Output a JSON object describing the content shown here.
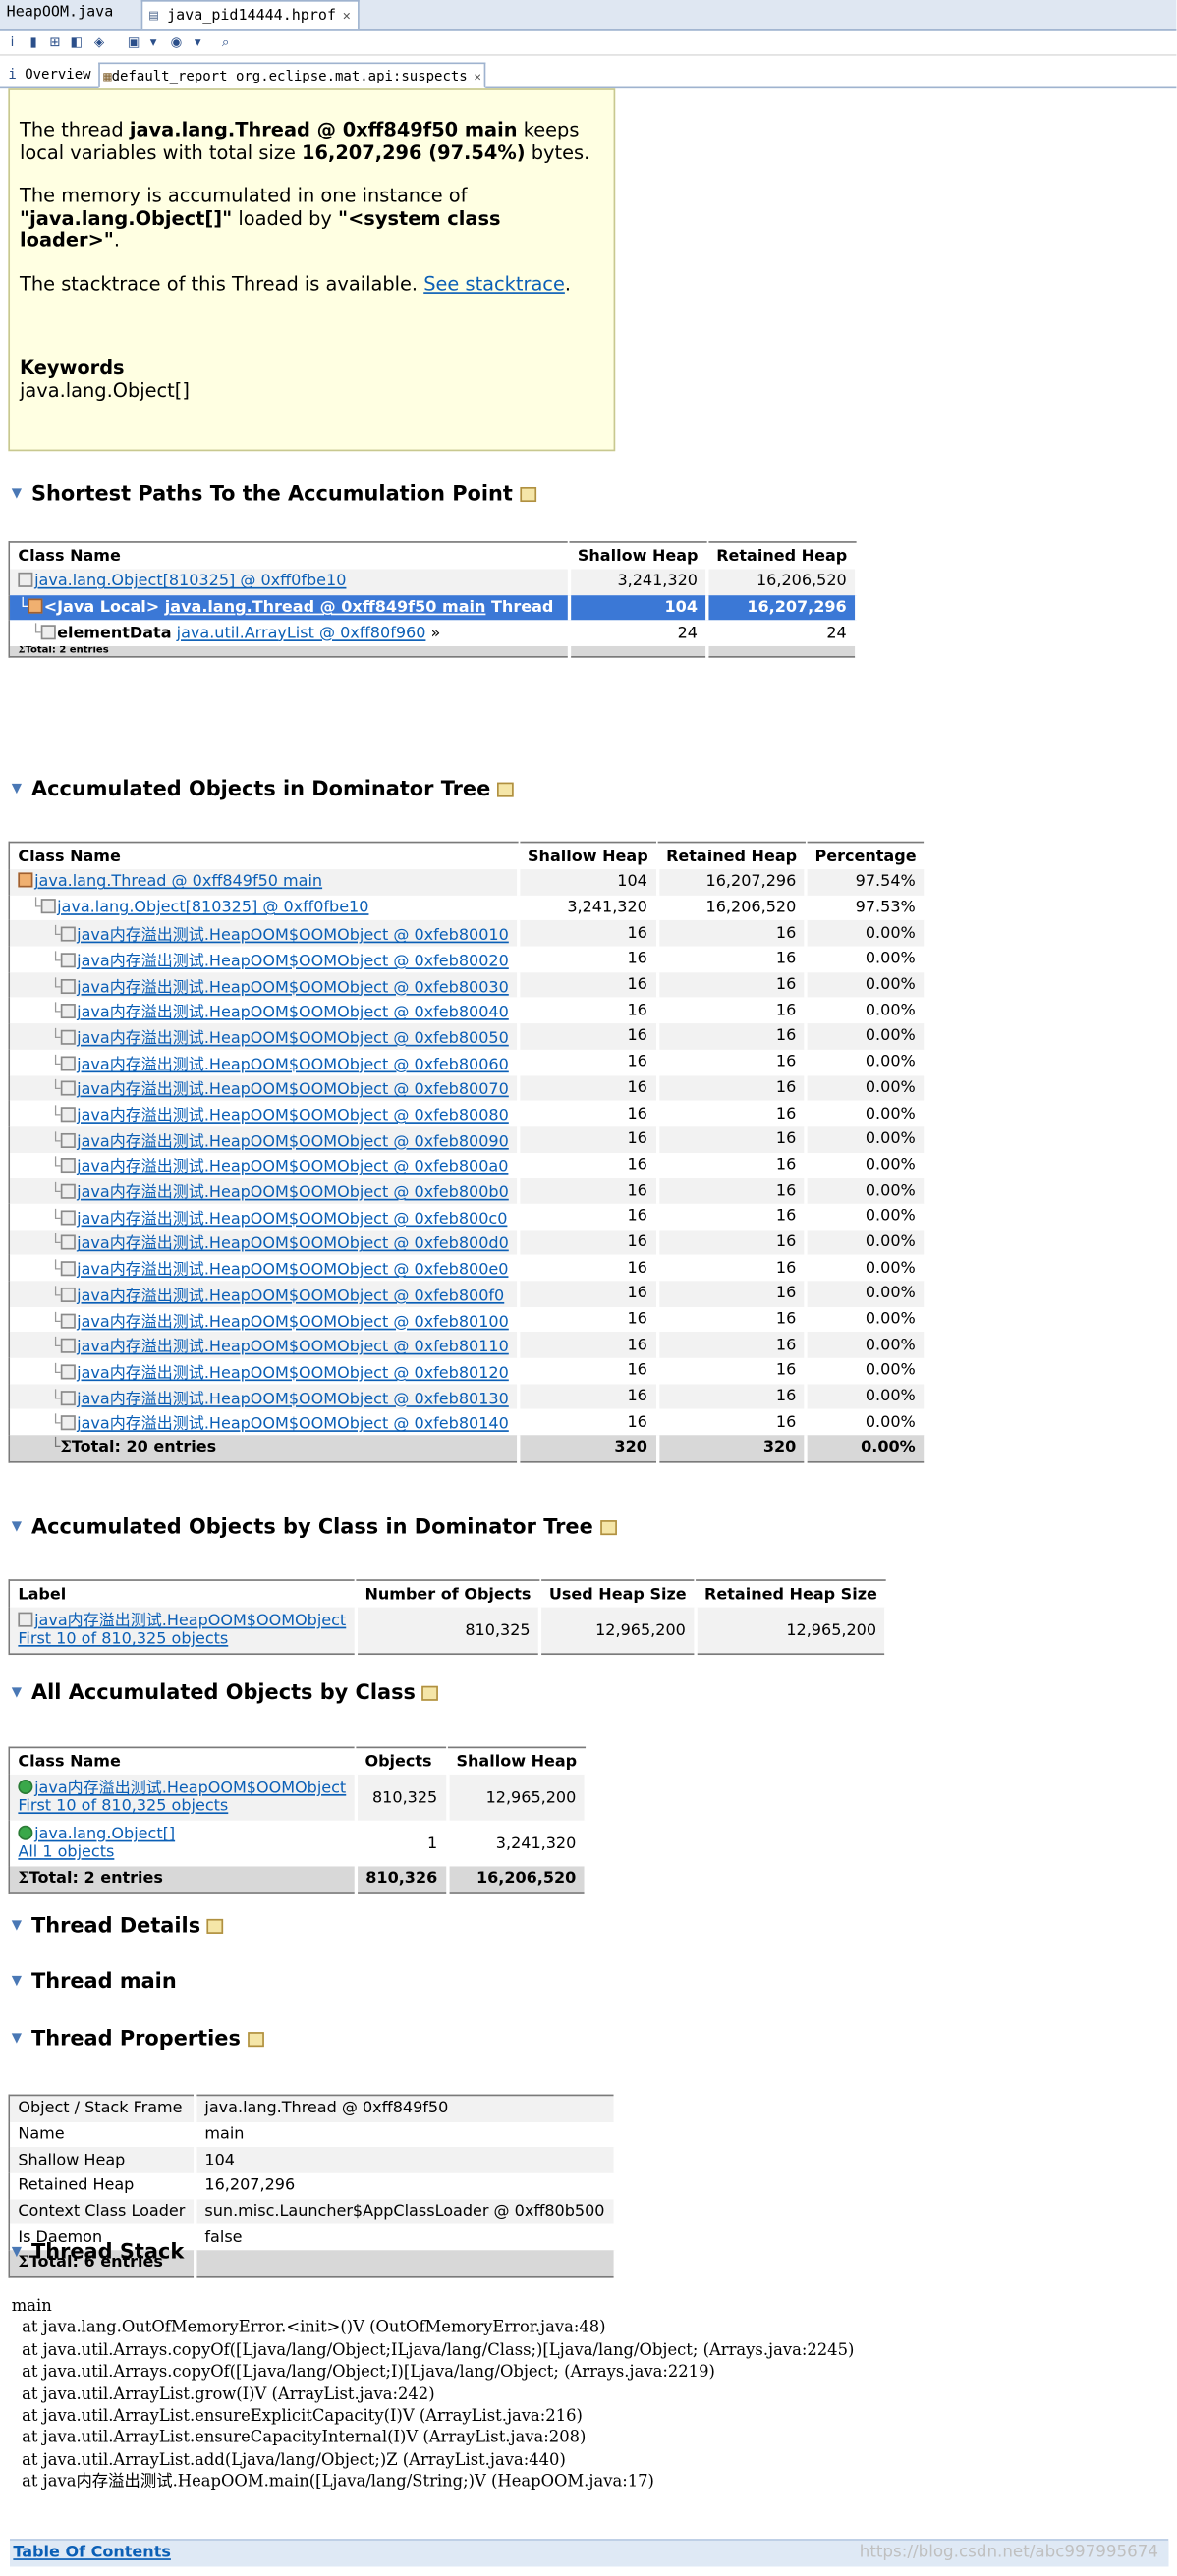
{
  "editor_tabs": [
    {
      "label": "HeapOOM.java"
    },
    {
      "label": "java_pid14444.hprof"
    }
  ],
  "sub_tabs": [
    {
      "label": "Overview"
    },
    {
      "label": "default_report  org.eclipse.mat.api:suspects"
    }
  ],
  "problem": {
    "p1_a": "The thread ",
    "p1_b": "java.lang.Thread @ 0xff849f50 main",
    "p1_c": " keeps local variables with total size ",
    "p1_d": "16,207,296 (97.54%)",
    "p1_e": " bytes.",
    "p2_a": "The memory is accumulated in one instance of ",
    "p2_b": "\"java.lang.Object[]\"",
    "p2_c": " loaded by ",
    "p2_d": "\"<system class loader>\"",
    "p2_e": ".",
    "p3_a": "The stacktrace of this Thread is available. ",
    "p3_link": "See stacktrace",
    "p3_e": ".",
    "keywords_title": "Keywords",
    "keywords_value": "java.lang.Object[]"
  },
  "sections": {
    "shortest": "Shortest Paths To the Accumulation Point",
    "dominator": "Accumulated Objects in Dominator Tree",
    "by_class_dom": "Accumulated Objects by Class in Dominator Tree",
    "all_by_class": "All Accumulated Objects by Class",
    "thread_details": "Thread Details",
    "thread_main": "Thread main",
    "thread_props": "Thread Properties",
    "thread_stack": "Thread Stack"
  },
  "shortest_table": {
    "headers": [
      "Class Name",
      "Shallow Heap",
      "Retained Heap"
    ],
    "rows": [
      {
        "name": "java.lang.Object[810325] @ 0xff0fbe10",
        "shallow": "3,241,320",
        "retained": "16,206,520"
      },
      {
        "prefix": "<Java Local>",
        "name": "java.lang.Thread @ 0xff849f50 main",
        "suffix": "Thread",
        "shallow": "104",
        "retained": "16,207,296"
      },
      {
        "prefix": "elementData",
        "name": "java.util.ArrayList @ 0xff80f960",
        "suffix": "»",
        "shallow": "24",
        "retained": "24"
      }
    ],
    "total": "Total: 2 entries"
  },
  "dominator_table": {
    "headers": [
      "Class Name",
      "Shallow Heap",
      "Retained Heap",
      "Percentage"
    ],
    "rows": [
      {
        "name": "java.lang.Thread @ 0xff849f50 main",
        "shallow": "104",
        "retained": "16,207,296",
        "pct": "97.54%"
      },
      {
        "name": "java.lang.Object[810325] @ 0xff0fbe10",
        "shallow": "3,241,320",
        "retained": "16,206,520",
        "pct": "97.53%"
      },
      {
        "name": "java内存溢出测试.HeapOOM$OOMObject @ 0xfeb80010",
        "shallow": "16",
        "retained": "16",
        "pct": "0.00%"
      },
      {
        "name": "java内存溢出测试.HeapOOM$OOMObject @ 0xfeb80020",
        "shallow": "16",
        "retained": "16",
        "pct": "0.00%"
      },
      {
        "name": "java内存溢出测试.HeapOOM$OOMObject @ 0xfeb80030",
        "shallow": "16",
        "retained": "16",
        "pct": "0.00%"
      },
      {
        "name": "java内存溢出测试.HeapOOM$OOMObject @ 0xfeb80040",
        "shallow": "16",
        "retained": "16",
        "pct": "0.00%"
      },
      {
        "name": "java内存溢出测试.HeapOOM$OOMObject @ 0xfeb80050",
        "shallow": "16",
        "retained": "16",
        "pct": "0.00%"
      },
      {
        "name": "java内存溢出测试.HeapOOM$OOMObject @ 0xfeb80060",
        "shallow": "16",
        "retained": "16",
        "pct": "0.00%"
      },
      {
        "name": "java内存溢出测试.HeapOOM$OOMObject @ 0xfeb80070",
        "shallow": "16",
        "retained": "16",
        "pct": "0.00%"
      },
      {
        "name": "java内存溢出测试.HeapOOM$OOMObject @ 0xfeb80080",
        "shallow": "16",
        "retained": "16",
        "pct": "0.00%"
      },
      {
        "name": "java内存溢出测试.HeapOOM$OOMObject @ 0xfeb80090",
        "shallow": "16",
        "retained": "16",
        "pct": "0.00%"
      },
      {
        "name": "java内存溢出测试.HeapOOM$OOMObject @ 0xfeb800a0",
        "shallow": "16",
        "retained": "16",
        "pct": "0.00%"
      },
      {
        "name": "java内存溢出测试.HeapOOM$OOMObject @ 0xfeb800b0",
        "shallow": "16",
        "retained": "16",
        "pct": "0.00%"
      },
      {
        "name": "java内存溢出测试.HeapOOM$OOMObject @ 0xfeb800c0",
        "shallow": "16",
        "retained": "16",
        "pct": "0.00%"
      },
      {
        "name": "java内存溢出测试.HeapOOM$OOMObject @ 0xfeb800d0",
        "shallow": "16",
        "retained": "16",
        "pct": "0.00%"
      },
      {
        "name": "java内存溢出测试.HeapOOM$OOMObject @ 0xfeb800e0",
        "shallow": "16",
        "retained": "16",
        "pct": "0.00%"
      },
      {
        "name": "java内存溢出测试.HeapOOM$OOMObject @ 0xfeb800f0",
        "shallow": "16",
        "retained": "16",
        "pct": "0.00%"
      },
      {
        "name": "java内存溢出测试.HeapOOM$OOMObject @ 0xfeb80100",
        "shallow": "16",
        "retained": "16",
        "pct": "0.00%"
      },
      {
        "name": "java内存溢出测试.HeapOOM$OOMObject @ 0xfeb80110",
        "shallow": "16",
        "retained": "16",
        "pct": "0.00%"
      },
      {
        "name": "java内存溢出测试.HeapOOM$OOMObject @ 0xfeb80120",
        "shallow": "16",
        "retained": "16",
        "pct": "0.00%"
      },
      {
        "name": "java内存溢出测试.HeapOOM$OOMObject @ 0xfeb80130",
        "shallow": "16",
        "retained": "16",
        "pct": "0.00%"
      },
      {
        "name": "java内存溢出测试.HeapOOM$OOMObject @ 0xfeb80140",
        "shallow": "16",
        "retained": "16",
        "pct": "0.00%"
      }
    ],
    "total": {
      "label": "Total: 20 entries",
      "shallow": "320",
      "retained": "320",
      "pct": "0.00%"
    }
  },
  "by_class_dom_table": {
    "headers": [
      "Label",
      "Number of Objects",
      "Used Heap Size",
      "Retained Heap Size"
    ],
    "row": {
      "name": "java内存溢出测试.HeapOOM$OOMObject",
      "sub": "First 10 of 810,325 objects",
      "count": "810,325",
      "used": "12,965,200",
      "retained": "12,965,200"
    }
  },
  "all_by_class_table": {
    "headers": [
      "Class Name",
      "Objects",
      "Shallow Heap"
    ],
    "rows": [
      {
        "name": "java内存溢出测试.HeapOOM$OOMObject",
        "sub": "First 10 of 810,325 objects",
        "objects": "810,325",
        "shallow": "12,965,200"
      },
      {
        "name": "java.lang.Object[]",
        "sub": "All 1 objects",
        "objects": "1",
        "shallow": "3,241,320"
      }
    ],
    "total": {
      "label": "Total: 2 entries",
      "objects": "810,326",
      "shallow": "16,206,520"
    }
  },
  "props_table": {
    "rows": [
      {
        "k": "Object / Stack Frame",
        "v": "java.lang.Thread @ 0xff849f50"
      },
      {
        "k": "Name",
        "v": "main"
      },
      {
        "k": "Shallow Heap",
        "v": "104"
      },
      {
        "k": "Retained Heap",
        "v": "16,207,296"
      },
      {
        "k": "Context Class Loader",
        "v": "sun.misc.Launcher$AppClassLoader @ 0xff80b500"
      },
      {
        "k": "Is Daemon",
        "v": "false"
      }
    ],
    "total": "Total: 6 entries"
  },
  "stack": [
    "main",
    "  at java.lang.OutOfMemoryError.<init>()V (OutOfMemoryError.java:48)",
    "  at java.util.Arrays.copyOf([Ljava/lang/Object;ILjava/lang/Class;)[Ljava/lang/Object; (Arrays.java:2245)",
    "  at java.util.Arrays.copyOf([Ljava/lang/Object;I)[Ljava/lang/Object; (Arrays.java:2219)",
    "  at java.util.ArrayList.grow(I)V (ArrayList.java:242)",
    "  at java.util.ArrayList.ensureExplicitCapacity(I)V (ArrayList.java:216)",
    "  at java.util.ArrayList.ensureCapacityInternal(I)V (ArrayList.java:208)",
    "  at java.util.ArrayList.add(Ljava/lang/Object;)Z (ArrayList.java:440)",
    "  at java内存溢出测试.HeapOOM.main([Ljava/lang/String;)V (HeapOOM.java:17)"
  ],
  "footer": {
    "link": "Table Of Contents",
    "watermark": "https://blog.csdn.net/abc997995674"
  }
}
